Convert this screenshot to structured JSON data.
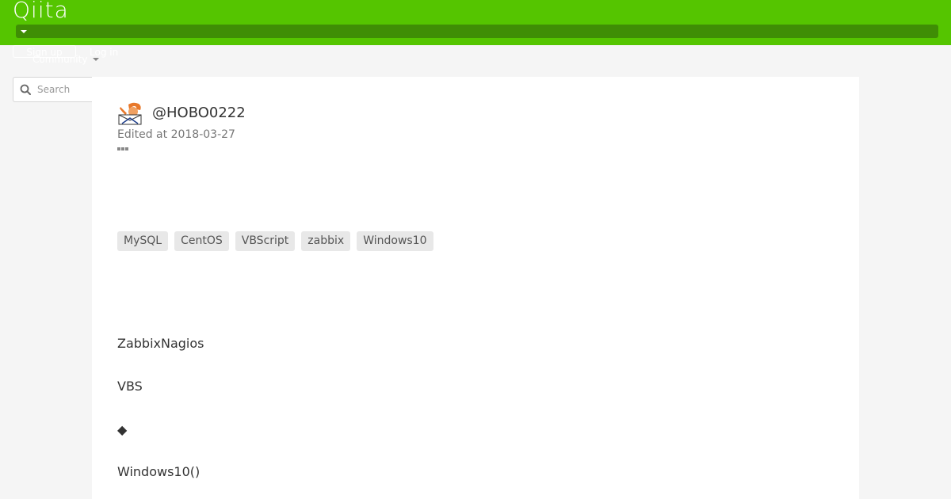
{
  "header": {
    "logo": "Qiita",
    "signup_label": "Sign up",
    "login_label": "Log in",
    "community_label": "Community"
  },
  "search": {
    "placeholder": "Search"
  },
  "article": {
    "author": "@HOBO0222",
    "edited": "Edited at 2018-03-27",
    "more_icon": "ellipsis-icon",
    "tags": [
      "MySQL",
      "CentOS",
      "VBScript",
      "zabbix",
      "Windows10"
    ],
    "body": [
      "ZabbixNagios",
      "VBS",
      "◆",
      "Windows10()"
    ]
  },
  "colors": {
    "brand": "#55c500",
    "brand_dark": "#3f8e05",
    "background": "#f5f5f5",
    "tag_bg": "#e8e8e8"
  }
}
